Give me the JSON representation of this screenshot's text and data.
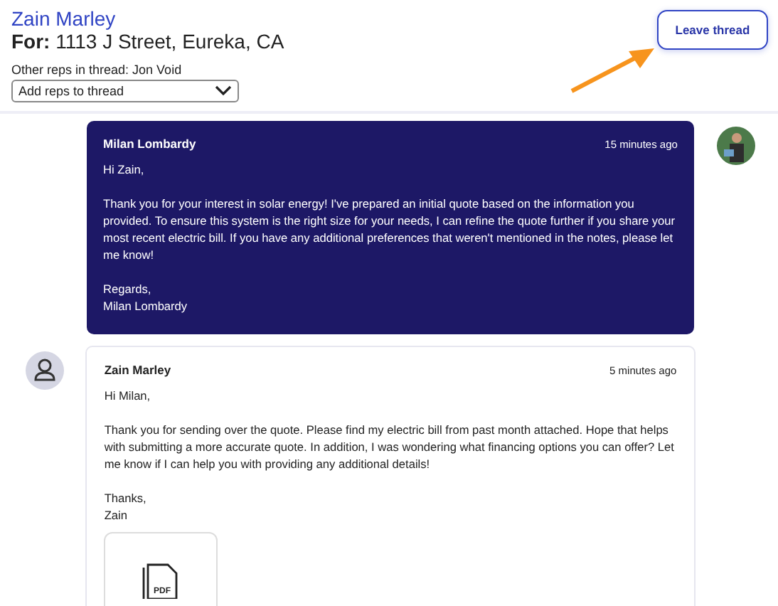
{
  "header": {
    "name": "Zain Marley",
    "address": "**For:** 1113 J Street, Eureka, CA",
    "reps_label": "Other reps in thread: Jon Void",
    "reps_select": {
      "placeholder": "Add reps to thread"
    },
    "leave_button": "Leave thread"
  },
  "messages": [
    {
      "kind": "sent",
      "author": "Milan Lombardy",
      "time": "15 minutes ago",
      "paragraphs": [
        "Hi Zain,",
        "Thank you for your interest in solar energy! I've prepared an initial quote based on the information you provided. To ensure this system is the right size for your needs, I can refine the quote further if you share your most recent electric bill. If you have any additional preferences that weren't mentioned in the notes, please let me know!",
        "Regards,\nMilan Lombardy"
      ]
    },
    {
      "kind": "received",
      "avatar": {
        "kind": "default"
      },
      "author": "Zain Marley",
      "time": "5 minutes ago",
      "paragraphs": [
        "Hi Milan,",
        "Thank you for sending over the quote. Please find my electric bill from past month attached. Hope that helps with submitting a more accurate quote. In addition, I was wondering what financing options you can offer? Let me know if I can help you with providing any additional details!",
        "Thanks,\nZain"
      ],
      "attachment": {
        "label": "PDF"
      }
    }
  ]
}
